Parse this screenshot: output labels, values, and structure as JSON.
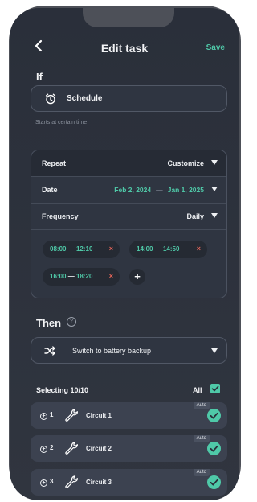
{
  "header": {
    "title": "Edit task",
    "save_label": "Save",
    "back_icon": "chevron-left-icon"
  },
  "if_section": {
    "title": "If",
    "trigger": {
      "icon": "alarm-clock-icon",
      "label": "Schedule"
    },
    "hint": "Starts at certain time"
  },
  "schedule_card": {
    "repeat": {
      "label": "Repeat",
      "value": "Customize"
    },
    "date": {
      "label": "Date",
      "start": "Feb 2, 2024",
      "separator": "—",
      "end": "Jan 1, 2025"
    },
    "frequency": {
      "label": "Frequency",
      "value": "Daily"
    },
    "time_ranges": [
      {
        "start": "08:00",
        "end": "12:10"
      },
      {
        "start": "14:00",
        "end": "14:50"
      },
      {
        "start": "16:00",
        "end": "18:20"
      }
    ],
    "range_separator": "—",
    "remove_glyph": "×",
    "add_glyph": "+"
  },
  "then_section": {
    "title": "Then",
    "help_glyph": "?",
    "action": {
      "icon": "shuffle-icon",
      "label": "Switch to battery backup"
    }
  },
  "selection": {
    "label": "Selecting 10/10",
    "all_label": "All",
    "circuits": [
      {
        "index": "1",
        "name": "Circuit 1",
        "badge": "Auto"
      },
      {
        "index": "2",
        "name": "Circuit 2",
        "badge": "Auto"
      },
      {
        "index": "3",
        "name": "Circuit 3",
        "badge": "Auto"
      }
    ]
  },
  "colors": {
    "accent": "#4fc9a8",
    "remove": "#e8665a",
    "background": "#2c313c"
  }
}
